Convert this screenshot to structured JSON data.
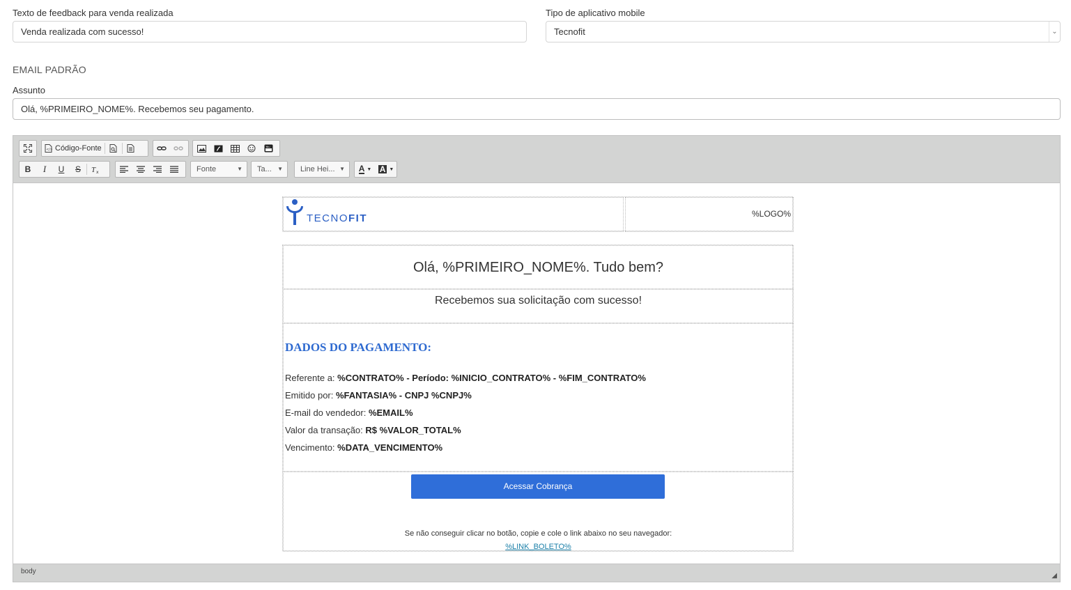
{
  "form": {
    "feedback_label": "Texto de feedback para venda realizada",
    "feedback_value": "Venda realizada com sucesso!",
    "app_type_label": "Tipo de aplicativo mobile",
    "app_type_value": "Tecnofit",
    "section_title": "EMAIL PADRÃO",
    "subject_label": "Assunto",
    "subject_value": "Olá, %PRIMEIRO_NOME%. Recebemos seu pagamento."
  },
  "toolbar": {
    "source_label": "Código-Fonte",
    "bold": "B",
    "italic": "I",
    "underline": "U",
    "strike": "S",
    "font_combo": "Fonte",
    "size_combo": "Ta...",
    "line_height_combo": "Line Hei...",
    "text_color": "A",
    "bg_color": "A"
  },
  "email": {
    "logo_text_light": "TECNO",
    "logo_text_bold": "FIT",
    "logo_placeholder": "%LOGO%",
    "greeting": "Olá, %PRIMEIRO_NOME%. Tudo bem?",
    "subtitle": "Recebemos sua solicitação com sucesso!",
    "data_title": "DADOS DO PAGAMENTO:",
    "lines": [
      {
        "label": "Referente a: ",
        "value": "%CONTRATO% - Período: %INICIO_CONTRATO% - %FIM_CONTRATO%"
      },
      {
        "label": "Emitido por: ",
        "value": "%FANTASIA% - CNPJ %CNPJ%"
      },
      {
        "label": "E-mail do vendedor: ",
        "value": "%EMAIL%"
      },
      {
        "label": "Valor da transação: ",
        "value": "R$ %VALOR_TOTAL%"
      },
      {
        "label": "Vencimento: ",
        "value": "%DATA_VENCIMENTO%"
      }
    ],
    "button_label": "Acessar Cobrança",
    "fallback_text": "Se não conseguir clicar no botão, copie e cole o link abaixo no seu navegador:",
    "fallback_link": "%LINK_BOLETO%"
  },
  "statusbar": {
    "path": "body"
  },
  "colors": {
    "accent_blue": "#2f6ed9",
    "title_blue": "#2e6ad0",
    "toolbar_gray": "#d3d4d3"
  }
}
